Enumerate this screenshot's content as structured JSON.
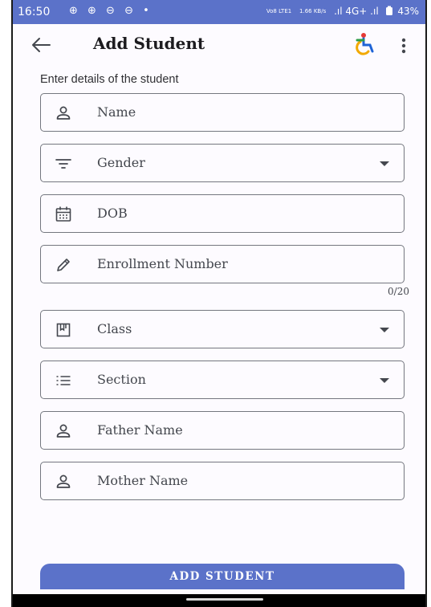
{
  "status_bar": {
    "time": "16:50",
    "left_icons": "⊕ ⊕ ⊖ ⊖ •",
    "network_1": "Vo8 LTE1",
    "network_2": "1.66 KB/s",
    "signal": ".ıl 4G+ .ıl",
    "battery": "43%"
  },
  "appbar": {
    "title": "Add Student",
    "back_icon": "arrow-back-icon",
    "accessibility_icon": "accessibility-icon",
    "menu_icon": "more-vert-icon"
  },
  "form": {
    "subtitle": "Enter details of the student",
    "fields": [
      {
        "label": "Name",
        "icon": "person-icon",
        "dropdown": false
      },
      {
        "label": "Gender",
        "icon": "filter-list-icon",
        "dropdown": true
      },
      {
        "label": "DOB",
        "icon": "calendar-icon",
        "dropdown": false
      },
      {
        "label": "Enrollment Number",
        "icon": "pencil-icon",
        "dropdown": false,
        "counter": "0/20"
      },
      {
        "label": "Class",
        "icon": "class-icon",
        "dropdown": true
      },
      {
        "label": "Section",
        "icon": "list-icon",
        "dropdown": true
      },
      {
        "label": "Father Name",
        "icon": "person-icon",
        "dropdown": false
      },
      {
        "label": "Mother Name",
        "icon": "person-icon",
        "dropdown": false
      }
    ]
  },
  "actions": {
    "add_student_label": "ADD STUDENT"
  },
  "colors": {
    "primary": "#5b72c9",
    "outline": "#74777f",
    "text": "#44474e"
  }
}
